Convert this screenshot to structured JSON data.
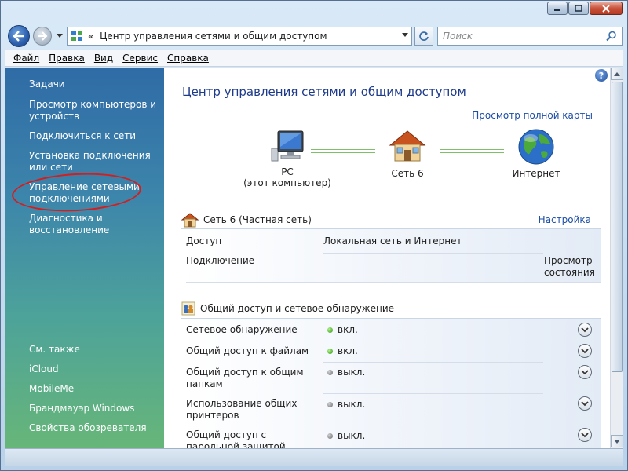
{
  "window": {
    "buttons": [
      "minimize",
      "maximize",
      "close"
    ]
  },
  "navigation": {
    "address_chevron": "«",
    "address_path": "Центр управления сетями и общим доступом",
    "search_placeholder": "Поиск"
  },
  "menu": {
    "items": [
      {
        "label": "Файл"
      },
      {
        "label": "Правка"
      },
      {
        "label": "Вид"
      },
      {
        "label": "Сервис"
      },
      {
        "label": "Справка"
      }
    ]
  },
  "sidebar": {
    "tasks_header": "Задачи",
    "tasks": [
      "Просмотр компьютеров и устройств",
      "Подключиться к сети",
      "Установка подключения или сети",
      "Управление сетевыми подключениями",
      "Диагностика и восстановление"
    ],
    "see_also_header": "См. также",
    "see_also": [
      "iCloud",
      "MobileMe",
      "Брандмауэр Windows",
      "Свойства обозревателя"
    ]
  },
  "main": {
    "help_icon": "?",
    "title": "Центр управления сетями и общим доступом",
    "full_map_link": "Просмотр полной карты",
    "map": {
      "pc_name": "PC",
      "pc_sub": "(этот компьютер)",
      "network_name": "Сеть  6",
      "internet_name": "Интернет"
    },
    "network": {
      "header": "Сеть  6 (Частная сеть)",
      "settings_link": "Настройка",
      "access_label": "Доступ",
      "access_value": "Локальная сеть и Интернет",
      "connection_label": "Подключение",
      "view_status_link_1": "Просмотр",
      "view_status_link_2": "состояния"
    },
    "sharing": {
      "header": "Общий доступ и сетевое обнаружение",
      "rows": [
        {
          "label": "Сетевое обнаружение",
          "state": "вкл.",
          "on": true
        },
        {
          "label": "Общий доступ к файлам",
          "state": "вкл.",
          "on": true
        },
        {
          "label": "Общий доступ к общим папкам",
          "state": "выкл.",
          "on": false
        },
        {
          "label": "Использование общих принтеров",
          "state": "выкл.",
          "on": false
        },
        {
          "label": "Общий доступ с парольной защитой",
          "state": "выкл.",
          "on": false
        }
      ]
    }
  },
  "colors": {
    "link": "#1d4fa8",
    "title": "#1e3a8a",
    "annotation_ellipse": "#d61d1d",
    "status_on": "#2e9a11",
    "status_off": "#6c6c6c"
  }
}
